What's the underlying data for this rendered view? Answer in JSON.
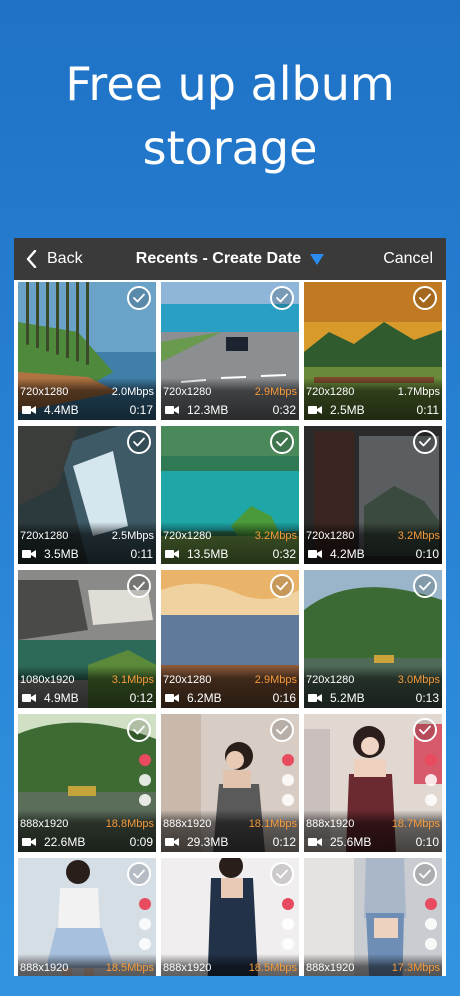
{
  "headline": {
    "line1": "Free up album",
    "line2": "storage"
  },
  "nav": {
    "back_label": "Back",
    "title": "Recents - Create Date",
    "cancel_label": "Cancel"
  },
  "colors": {
    "accent_blue": "#1f72c6",
    "rate_highlight": "#f59a3b",
    "navbar": "#3a3a3a"
  },
  "videos": [
    {
      "resolution": "720x1280",
      "bitrate": "2.0Mbps",
      "bitrate_highlight": false,
      "size": "4.4MB",
      "duration": "0:17",
      "scene": "coast-trees"
    },
    {
      "resolution": "720x1280",
      "bitrate": "2.9Mbps",
      "bitrate_highlight": true,
      "size": "12.3MB",
      "duration": "0:32",
      "scene": "seaside-road"
    },
    {
      "resolution": "720x1280",
      "bitrate": "1.7Mbps",
      "bitrate_highlight": false,
      "size": "2.5MB",
      "duration": "0:11",
      "scene": "mountain-sunset"
    },
    {
      "resolution": "720x1280",
      "bitrate": "2.5Mbps",
      "bitrate_highlight": false,
      "size": "3.5MB",
      "duration": "0:11",
      "scene": "waterfall"
    },
    {
      "resolution": "720x1280",
      "bitrate": "3.2Mbps",
      "bitrate_highlight": true,
      "size": "13.5MB",
      "duration": "0:32",
      "scene": "green-lake"
    },
    {
      "resolution": "720x1280",
      "bitrate": "3.2Mbps",
      "bitrate_highlight": true,
      "size": "4.2MB",
      "duration": "0:10",
      "scene": "dark-window"
    },
    {
      "resolution": "1080x1920",
      "bitrate": "3.1Mbps",
      "bitrate_highlight": true,
      "size": "4.9MB",
      "duration": "0:12",
      "scene": "old-town"
    },
    {
      "resolution": "720x1280",
      "bitrate": "2.9Mbps",
      "bitrate_highlight": true,
      "size": "6.2MB",
      "duration": "0:16",
      "scene": "sunset-sea"
    },
    {
      "resolution": "720x1280",
      "bitrate": "3.0Mbps",
      "bitrate_highlight": true,
      "size": "5.2MB",
      "duration": "0:13",
      "scene": "river-boat"
    },
    {
      "resolution": "888x1920",
      "bitrate": "18.8Mbps",
      "bitrate_highlight": true,
      "size": "22.6MB",
      "duration": "0:09",
      "scene": "park-pond"
    },
    {
      "resolution": "888x1920",
      "bitrate": "18.1Mbps",
      "bitrate_highlight": true,
      "size": "29.3MB",
      "duration": "0:12",
      "scene": "woman-dress"
    },
    {
      "resolution": "888x1920",
      "bitrate": "18.7Mbps",
      "bitrate_highlight": true,
      "size": "25.6MB",
      "duration": "0:10",
      "scene": "woman-room"
    },
    {
      "resolution": "888x1920",
      "bitrate": "18.5Mbps",
      "bitrate_highlight": true,
      "size": "",
      "duration": "",
      "scene": "woman-skirt"
    },
    {
      "resolution": "888x1920",
      "bitrate": "18.5Mbps",
      "bitrate_highlight": true,
      "size": "",
      "duration": "",
      "scene": "woman-black"
    },
    {
      "resolution": "888x1920",
      "bitrate": "17.3Mbps",
      "bitrate_highlight": true,
      "size": "",
      "duration": "",
      "scene": "woman-jeans"
    }
  ]
}
